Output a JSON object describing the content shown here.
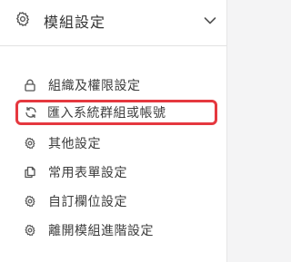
{
  "header": {
    "title": "模組設定",
    "icon": "gear-icon",
    "toggle_icon": "chevron-down-icon"
  },
  "menu": {
    "items": [
      {
        "label": "組織及權限設定",
        "icon": "lock-icon"
      },
      {
        "label": "匯入系統群組或帳號",
        "icon": "sync-icon",
        "highlighted": true
      },
      {
        "label": "其他設定",
        "icon": "gear-icon"
      },
      {
        "label": "常用表單設定",
        "icon": "document-copy-icon"
      },
      {
        "label": "自訂欄位設定",
        "icon": "gear-icon"
      },
      {
        "label": "離開模組進階設定",
        "icon": "gear-icon"
      }
    ]
  },
  "colors": {
    "highlight_border": "#e5383f",
    "text": "#3d3d3d",
    "divider": "#e2e2e2"
  }
}
